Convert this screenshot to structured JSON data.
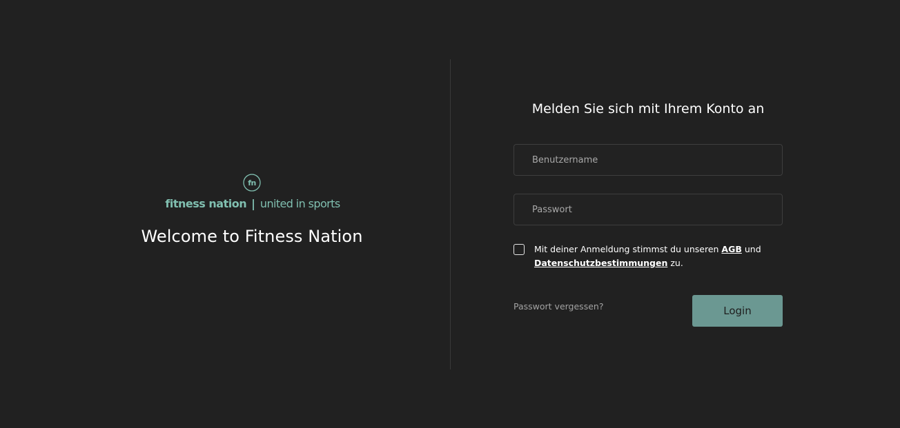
{
  "branding": {
    "logo_mark_text": "fn",
    "brand_name": "fitness nation",
    "separator": "|",
    "tagline": "united in sports",
    "welcome": "Welcome to Fitness Nation",
    "accent_color": "#80bfb0"
  },
  "login": {
    "title": "Melden Sie sich mit Ihrem Konto an",
    "username_placeholder": "Benutzername",
    "password_placeholder": "Passwort",
    "consent": {
      "checked": false,
      "text_before": "Mit deiner Anmeldung stimmst du unseren ",
      "agb_link": "AGB",
      "text_middle": " und ",
      "privacy_link": "Datenschutzbestimmungen",
      "text_after": " zu."
    },
    "forgot_password": "Passwort vergessen?",
    "submit_label": "Login",
    "button_color": "#6b9892"
  }
}
